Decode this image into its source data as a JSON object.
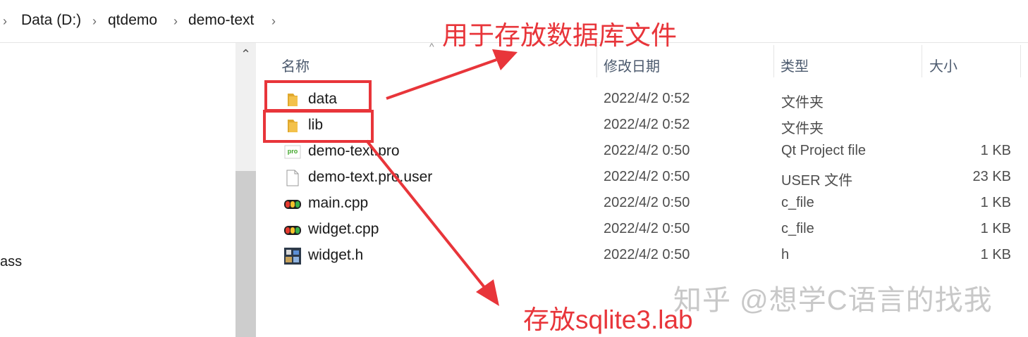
{
  "breadcrumb": {
    "items": [
      "Data (D:)",
      "qtdemo",
      "demo-text"
    ]
  },
  "nav": {
    "partial_item": "ass"
  },
  "columns": {
    "name": "名称",
    "date": "修改日期",
    "type": "类型",
    "size": "大小"
  },
  "files": [
    {
      "name": "data",
      "date": "2022/4/2 0:52",
      "type": "文件夹",
      "size": "",
      "icon": "folder-icon"
    },
    {
      "name": "lib",
      "date": "2022/4/2 0:52",
      "type": "文件夹",
      "size": "",
      "icon": "folder-icon"
    },
    {
      "name": "demo-text.pro",
      "date": "2022/4/2 0:50",
      "type": "Qt Project file",
      "size": "1 KB",
      "icon": "qt-pro-file-icon"
    },
    {
      "name": "demo-text.pro.user",
      "date": "2022/4/2 0:50",
      "type": "USER 文件",
      "size": "23 KB",
      "icon": "blank-file-icon"
    },
    {
      "name": "main.cpp",
      "date": "2022/4/2 0:50",
      "type": "c_file",
      "size": "1 KB",
      "icon": "cpp-file-icon"
    },
    {
      "name": "widget.cpp",
      "date": "2022/4/2 0:50",
      "type": "c_file",
      "size": "1 KB",
      "icon": "cpp-file-icon"
    },
    {
      "name": "widget.h",
      "date": "2022/4/2 0:50",
      "type": "h",
      "size": "1 KB",
      "icon": "header-file-icon"
    }
  ],
  "annotations": {
    "top": "用于存放数据库文件",
    "bottom": "存放sqlite3.lab"
  },
  "watermark": "知乎 @想学C语言的找我",
  "colors": {
    "annotation": "#e8353a",
    "folder": "#f3c14b",
    "header_text": "#4c5a6e"
  }
}
